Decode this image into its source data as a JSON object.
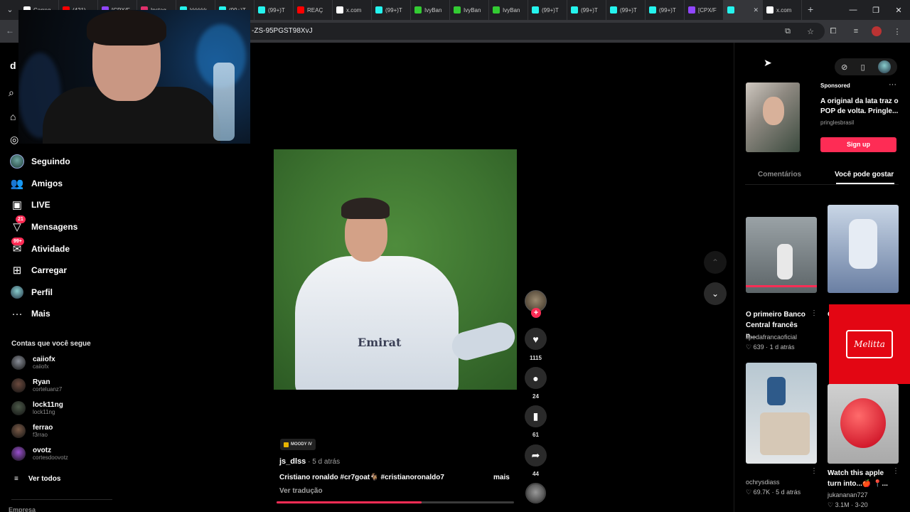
{
  "browser": {
    "tabs": [
      {
        "label": "Carreg",
        "color": "#ffffff"
      },
      {
        "label": "(421)",
        "color": "#ff0000"
      },
      {
        "label": "[CPX/F",
        "color": "#9146ff"
      },
      {
        "label": "Instag",
        "color": "#e1306c"
      },
      {
        "label": "kkkkkk",
        "color": "#25f4ee"
      },
      {
        "label": "(99+)T",
        "color": "#25f4ee"
      },
      {
        "label": "(99+)T",
        "color": "#25f4ee"
      },
      {
        "label": "REAÇ",
        "color": "#ff0000"
      },
      {
        "label": "x.com",
        "color": "#ffffff"
      },
      {
        "label": "(99+)T",
        "color": "#25f4ee"
      },
      {
        "label": "IvyBan",
        "color": "#33cc33"
      },
      {
        "label": "IvyBan",
        "color": "#33cc33"
      },
      {
        "label": "IvyBan",
        "color": "#33cc33"
      },
      {
        "label": "(99+)T",
        "color": "#25f4ee"
      },
      {
        "label": "(99+)T",
        "color": "#25f4ee"
      },
      {
        "label": "(99+)T",
        "color": "#25f4ee"
      },
      {
        "label": "(99+)T",
        "color": "#25f4ee"
      },
      {
        "label": "[CPX/F",
        "color": "#9146ff"
      },
      {
        "label": "",
        "color": "#25f4ee",
        "active": true
      },
      {
        "label": "x.com",
        "color": "#ffffff"
      }
    ],
    "url": "-ZS-95PGST98XvJ"
  },
  "sidebar": {
    "logo": "d",
    "nav": [
      {
        "label": "Seguindo"
      },
      {
        "label": "Amigos"
      },
      {
        "label": "LIVE"
      },
      {
        "label": "Mensagens",
        "badge": "21"
      },
      {
        "label": "Atividade",
        "badge": "99+"
      },
      {
        "label": "Carregar"
      },
      {
        "label": "Perfil"
      },
      {
        "label": "Mais"
      }
    ],
    "following_header": "Contas que você segue",
    "following": [
      {
        "name": "caiiofx",
        "user": "caiiofx",
        "color": "#8a8f98"
      },
      {
        "name": "Ryan",
        "user": "corteluanz7",
        "color": "#6b4a3e"
      },
      {
        "name": "lock11ng",
        "user": "lock11ng",
        "color": "#4d5a4a"
      },
      {
        "name": "ferrao",
        "user": "f3rrao",
        "color": "#7a5b48"
      },
      {
        "name": "ovotz",
        "user": "cortesdoovotz",
        "color": "#9a4fd0"
      }
    ],
    "see_all": "Ver todos",
    "footer": "Empresa"
  },
  "video": {
    "jersey_text": "Emirat",
    "music_tag": "MOODY IV",
    "author": "js_dlss",
    "time": " · 5 d atrás",
    "caption": "Cristiano ronaldo #cr7goat🐐 #cristianoronaldo7",
    "more": "mais",
    "translate": "Ver tradução",
    "progress": 0.61,
    "likes": "1115",
    "comments": "24",
    "saves": "61",
    "shares": "44"
  },
  "right_panel": {
    "ad": {
      "sponsored": "Sponsored",
      "title": "A original da lata traz o POP de volta. Pringle...",
      "brand": "pringlesbrasil",
      "button": "Sign up"
    },
    "tabs": {
      "comments": "Comentários",
      "suggested": "Você pode gostar"
    },
    "cards": [
      {
        "title": "O primeiro Banco Central francês n...",
        "author": "lipedafrancaoficial",
        "likes": "639",
        "time": "1 d atrás"
      },
      {
        "title": "O",
        "author": "",
        "likes": "",
        "time": ""
      },
      {
        "title": "",
        "author": "ochrysdiass",
        "likes": "69.7K",
        "time": "5 d atrás"
      },
      {
        "title": "Watch this apple turn into...🍎 📍...",
        "author": "jukananan727",
        "likes": "3.1M",
        "time": "3-20"
      }
    ],
    "promo": "Melitta"
  }
}
